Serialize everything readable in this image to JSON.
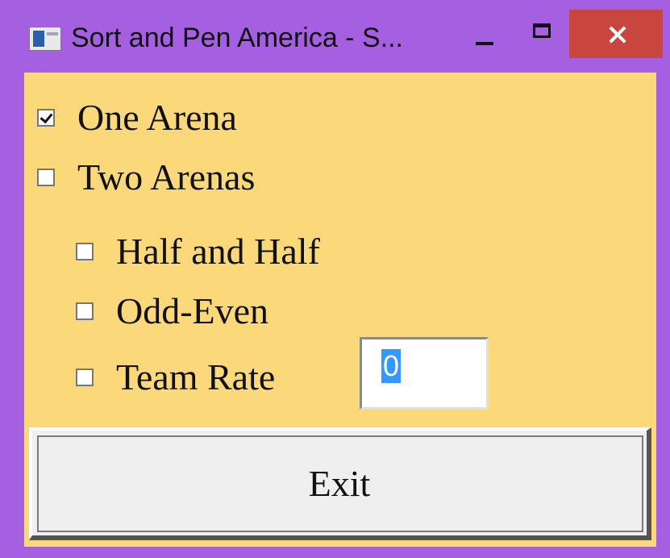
{
  "window": {
    "title": "Sort and Pen America - S...",
    "title_bar_color": "#a460e0",
    "client_background": "#fbd97a",
    "close_button_color": "#c9463f",
    "icons": {
      "app": "app-window-icon",
      "minimize": "minimize-icon",
      "maximize": "maximize-icon",
      "close": "close-icon"
    }
  },
  "options": {
    "one_arena": {
      "label": "One Arena",
      "checked": true
    },
    "two_arenas": {
      "label": "Two Arenas",
      "checked": false
    },
    "half_and_half": {
      "label": "Half and Half",
      "checked": false
    },
    "odd_even": {
      "label": "Odd-Even",
      "checked": false
    },
    "team_rate": {
      "label": "Team Rate",
      "checked": false
    }
  },
  "team_rate_input": {
    "value": "0",
    "selection_color": "#3399ff"
  },
  "exit_button": {
    "label": "Exit"
  }
}
